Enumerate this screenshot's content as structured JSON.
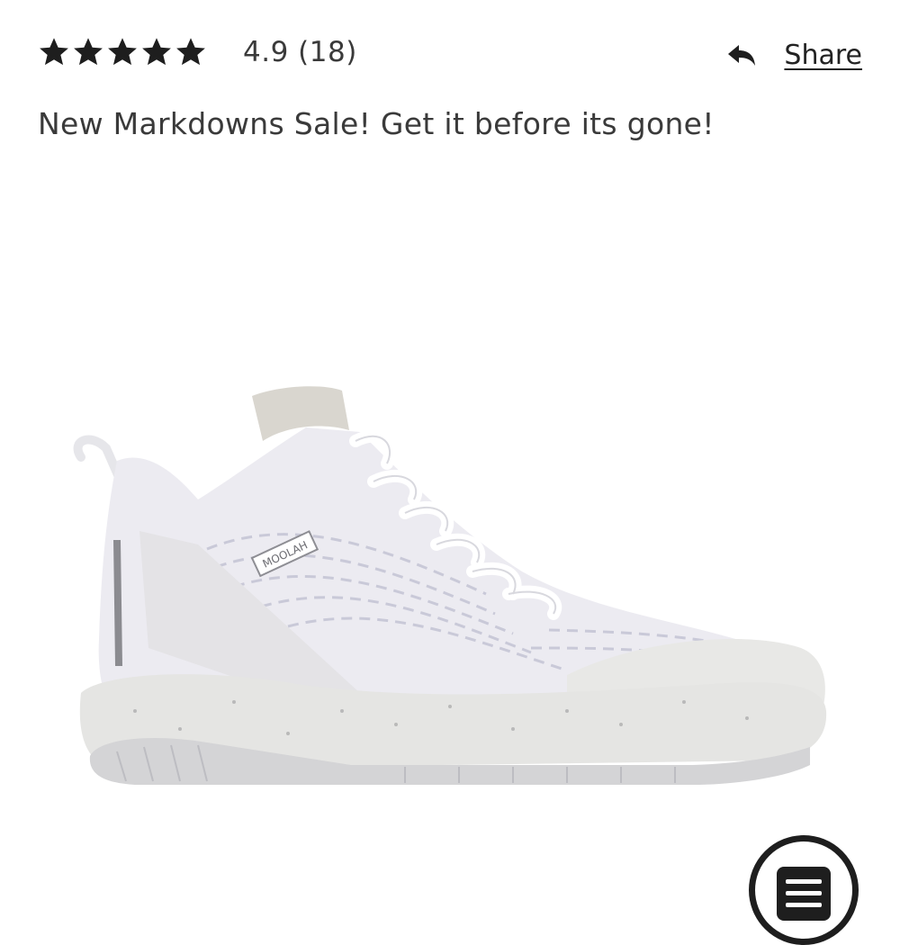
{
  "rating": {
    "stars_filled": 5,
    "stars_total": 5,
    "text": "4.9 (18)"
  },
  "share": {
    "label": "Share",
    "icon": "reply-arrow-icon"
  },
  "promo": {
    "text": "New Markdowns Sale! Get it before its gone!"
  },
  "product": {
    "image": "white-basketball-shoe",
    "tongue_badge": "MOOLAH"
  },
  "fab": {
    "icon": "menu-icon"
  },
  "colors": {
    "text": "#222222",
    "muted_text": "#3a3a3a",
    "star": "#1e1e1e"
  }
}
